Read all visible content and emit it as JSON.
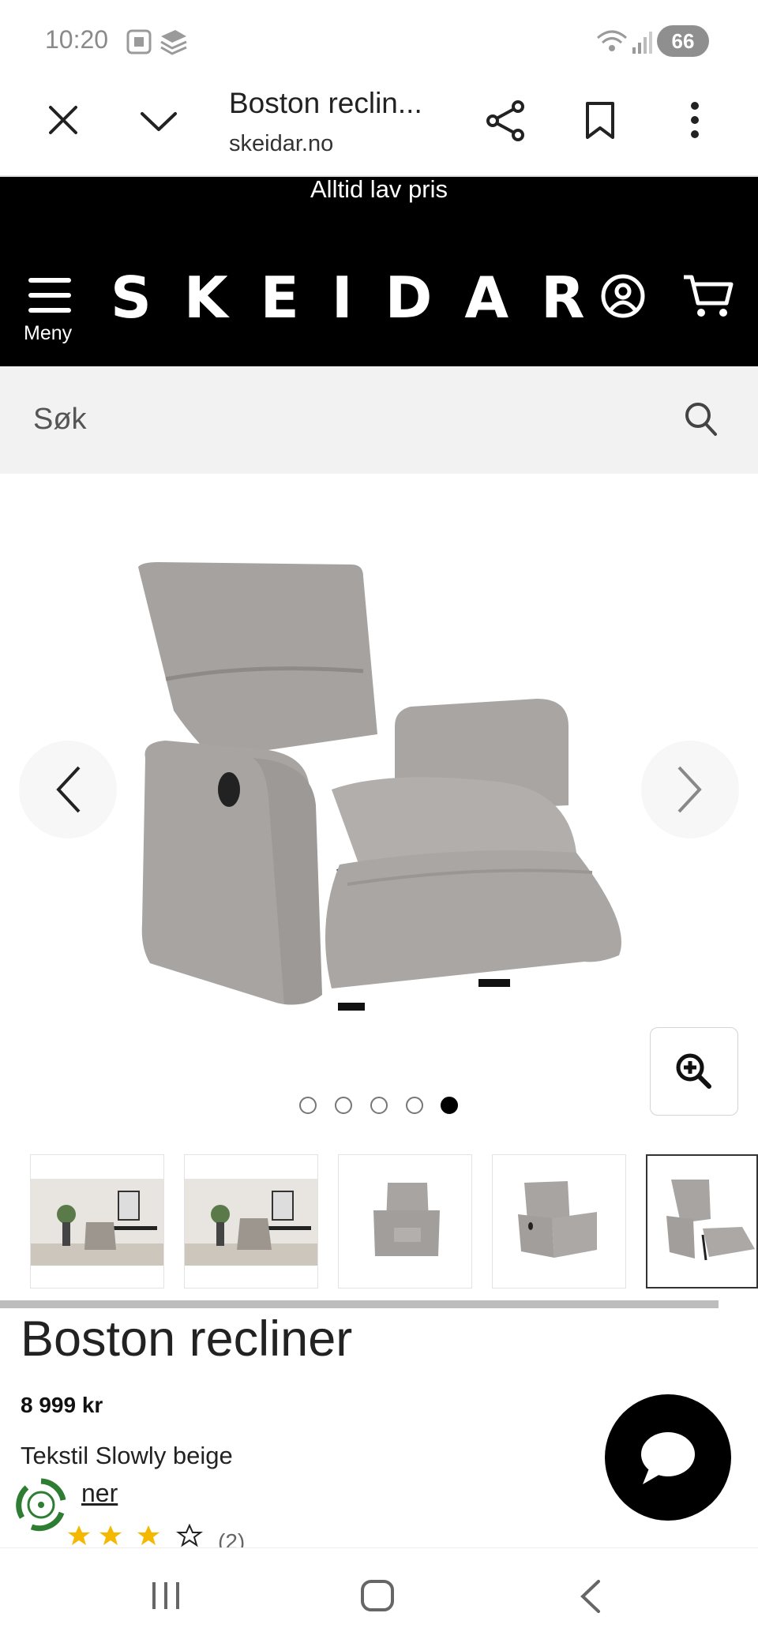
{
  "status_bar": {
    "time": "10:20",
    "battery": "66"
  },
  "browser": {
    "title": "Boston reclin...",
    "url": "skeidar.no"
  },
  "site": {
    "promo": "Alltid lav pris",
    "logo": "SKEIDAR",
    "menu_label": "Meny"
  },
  "search": {
    "placeholder": "Søk"
  },
  "gallery": {
    "total_images": 5,
    "active_index": 5
  },
  "product": {
    "title": "Boston recliner",
    "price": "8 999 kr",
    "variant": "Tekstil Slowly beige",
    "link_partial": "ner",
    "rating_count": "(2)"
  },
  "icons": [
    "close-icon",
    "chevron-down-icon",
    "share-icon",
    "bookmark-icon",
    "more-vert-icon",
    "hamburger-icon",
    "account-icon",
    "cart-icon",
    "search-icon",
    "chevron-left-icon",
    "chevron-right-icon",
    "zoom-in-icon",
    "chat-icon",
    "recycle-badge-icon"
  ],
  "colors": {
    "header_bg": "#000000",
    "search_bg": "#f2f2f2",
    "star": "#f5b800",
    "chair": "#a7a3a0"
  }
}
